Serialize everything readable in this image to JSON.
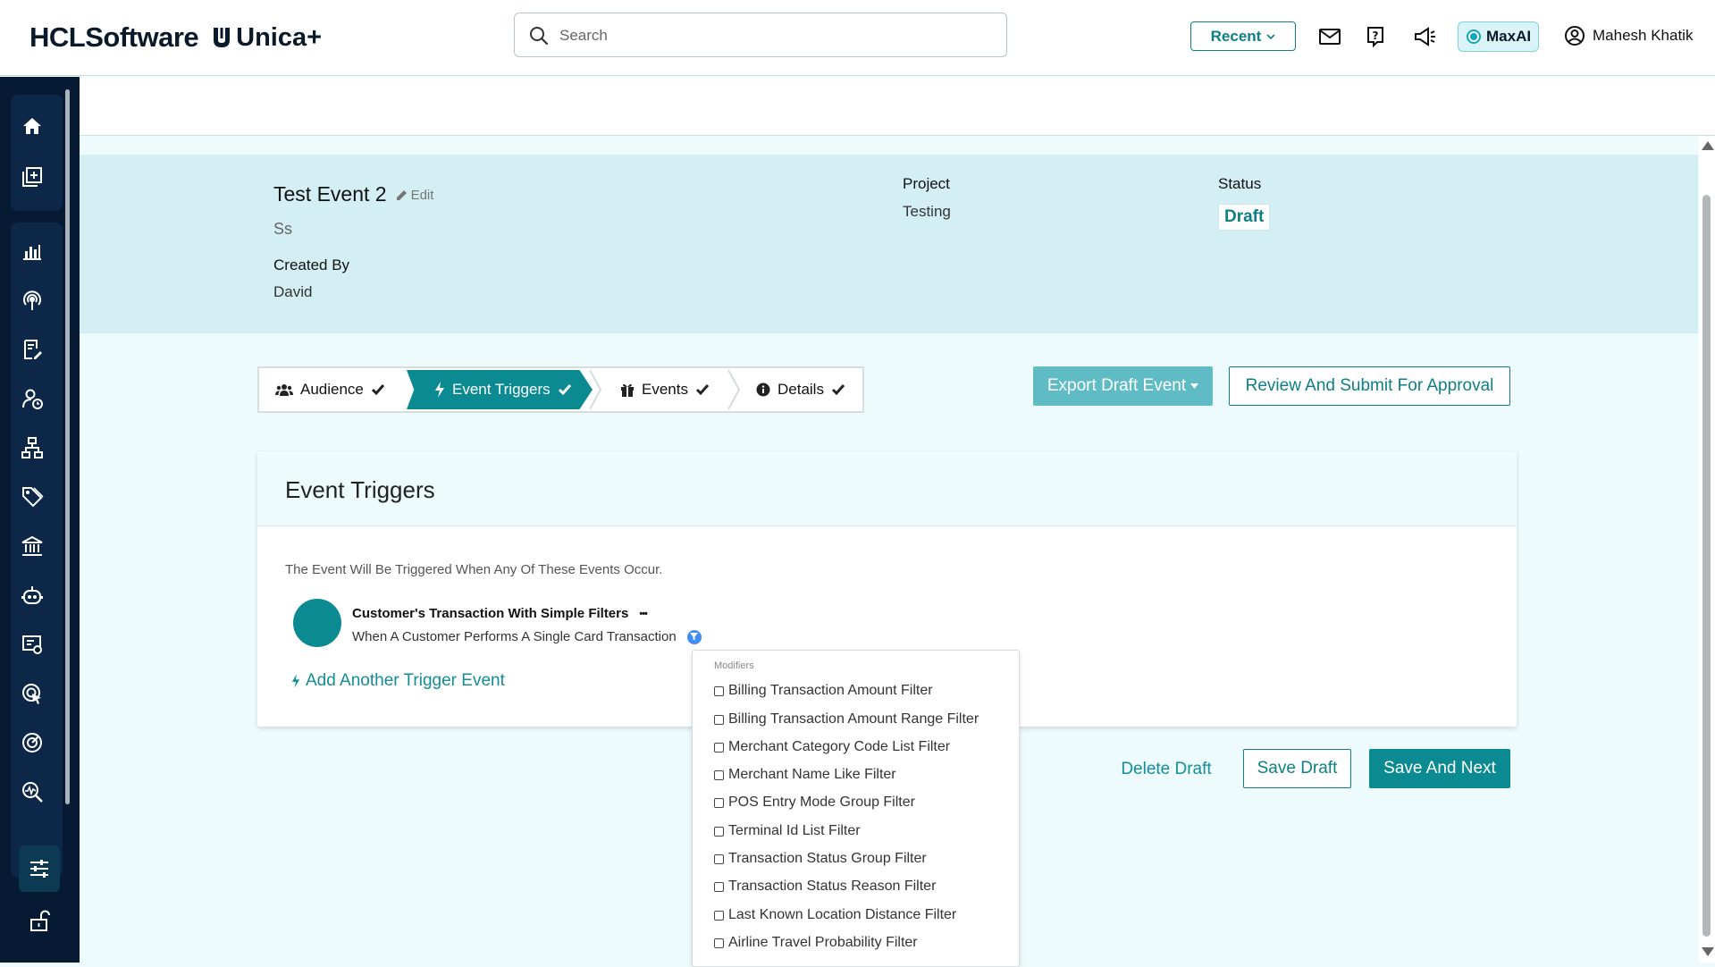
{
  "header": {
    "brand_name": "HCLSoftware",
    "product_name": "Unica+",
    "search_placeholder": "Search",
    "recent_label": "Recent",
    "maxai_label": "MaxAI",
    "user_name": "Mahesh Khatik"
  },
  "event": {
    "title": "Test Event 2",
    "edit_label": "Edit",
    "subtitle": "Ss",
    "created_by_label": "Created By",
    "created_by_value": "David",
    "project_label": "Project",
    "project_value": "Testing",
    "status_label": "Status",
    "status_value": "Draft"
  },
  "steps": [
    {
      "label": "Audience",
      "icon": "users-icon",
      "completed": true,
      "active": false
    },
    {
      "label": "Event Triggers",
      "icon": "bolt-icon",
      "completed": true,
      "active": true
    },
    {
      "label": "Events",
      "icon": "gift-icon",
      "completed": true,
      "active": false
    },
    {
      "label": "Details",
      "icon": "info-icon",
      "completed": true,
      "active": false
    }
  ],
  "actions": {
    "export_label": "Export Draft Event",
    "review_label": "Review And Submit For Approval",
    "delete_label": "Delete Draft",
    "save_draft_label": "Save Draft",
    "save_next_label": "Save And Next"
  },
  "card": {
    "title": "Event Triggers",
    "description": "The Event Will Be Triggered When Any Of These Events Occur.",
    "trigger_name": "Customer's Transaction With Simple Filters",
    "trigger_more": "•••",
    "trigger_sub": "When A Customer Performs A Single Card Transaction",
    "add_trigger_label": "Add Another Trigger Event"
  },
  "modifiers": {
    "heading": "Modifiers",
    "items": [
      "Billing Transaction Amount Filter",
      "Billing Transaction Amount Range Filter",
      "Merchant Category Code List Filter",
      "Merchant Name Like Filter",
      "POS Entry Mode Group Filter",
      "Terminal Id List Filter",
      "Transaction Status Group Filter",
      "Transaction Status Reason Filter",
      "Last Known Location Distance Filter",
      "Airline Travel Probability Filter"
    ]
  },
  "colors": {
    "accent": "#0b8a92",
    "sidebar": "#061a33",
    "panel": "#d4eff3",
    "page_bg": "#eefbfd"
  }
}
